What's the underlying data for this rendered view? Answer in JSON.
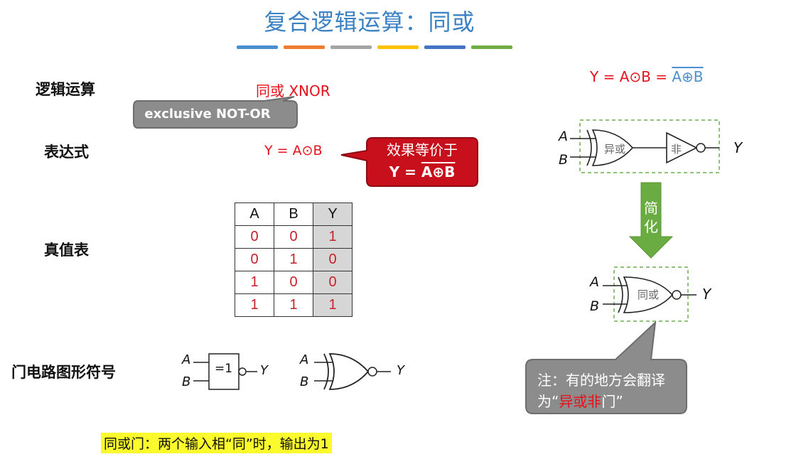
{
  "title": "复合逻辑运算：同或",
  "accent_bars": [
    "#4a90d0",
    "#ed7d31",
    "#a5a5a5",
    "#ffc000",
    "#4472c4",
    "#70ad47"
  ],
  "labels": {
    "logic_op": "逻辑运算",
    "expression": "表达式",
    "truth_table": "真值表",
    "gate_symbol": "门电路图形符号"
  },
  "xnor_name": "同或 XNOR",
  "xnor_callout": "exclusive NOT-OR",
  "expression_value": "Y = A⊙B",
  "equiv_callout": {
    "line1": "效果等价于",
    "line2_prefix": "Y = ",
    "line2_overlined": "A⊕B"
  },
  "truth_table": {
    "headers": [
      "A",
      "B",
      "Y"
    ],
    "rows": [
      [
        "0",
        "0",
        "1"
      ],
      [
        "0",
        "1",
        "0"
      ],
      [
        "1",
        "0",
        "0"
      ],
      [
        "1",
        "1",
        "1"
      ]
    ]
  },
  "gate_symbols": {
    "input_a": "A",
    "input_b": "B",
    "output": "Y",
    "ieee_box_label": "=1"
  },
  "right_formula": {
    "prefix": "Y = A⊙B = ",
    "overlined": "A⊕B"
  },
  "diagram": {
    "xor_label": "异或",
    "not_label": "非",
    "simplify_label": "简化",
    "xnor_label": "同或"
  },
  "note": {
    "text_before": "注：有的地方会翻译为“",
    "highlight": "异或非",
    "text_after": "门”"
  },
  "bottom_note": "同或门：两个输入相“同”时，输出为1"
}
